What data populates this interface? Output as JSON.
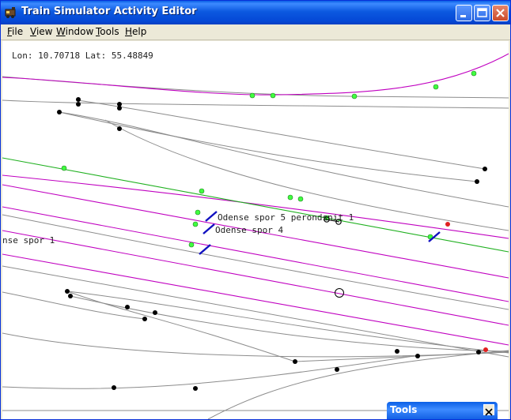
{
  "window": {
    "title": "Train Simulator Activity Editor"
  },
  "menu": {
    "file": {
      "underlined": "F",
      "rest": "ile"
    },
    "view": {
      "underlined": "V",
      "rest": "iew"
    },
    "window": {
      "underlined": "W",
      "rest": "indow"
    },
    "tools": {
      "underlined": "T",
      "rest": "ools"
    },
    "help": {
      "underlined": "H",
      "rest": "elp"
    }
  },
  "map": {
    "coordinates": "Lon: 10.70718 Lat: 55.48849",
    "labels": {
      "platform_5": "Odense spor 5 perondsnit 1",
      "platform_4": "Odense spor 4",
      "platform_1": "nse spor 1"
    },
    "colors": {
      "track": "#8c8c8c",
      "magenta_track": "#c000c0",
      "green_track": "#20b020",
      "node_black": "#000000",
      "node_green": "#40ff40",
      "node_red": "#e02020",
      "signal_blue": "#1010c0"
    }
  },
  "tools_panel": {
    "title": "Tools"
  }
}
